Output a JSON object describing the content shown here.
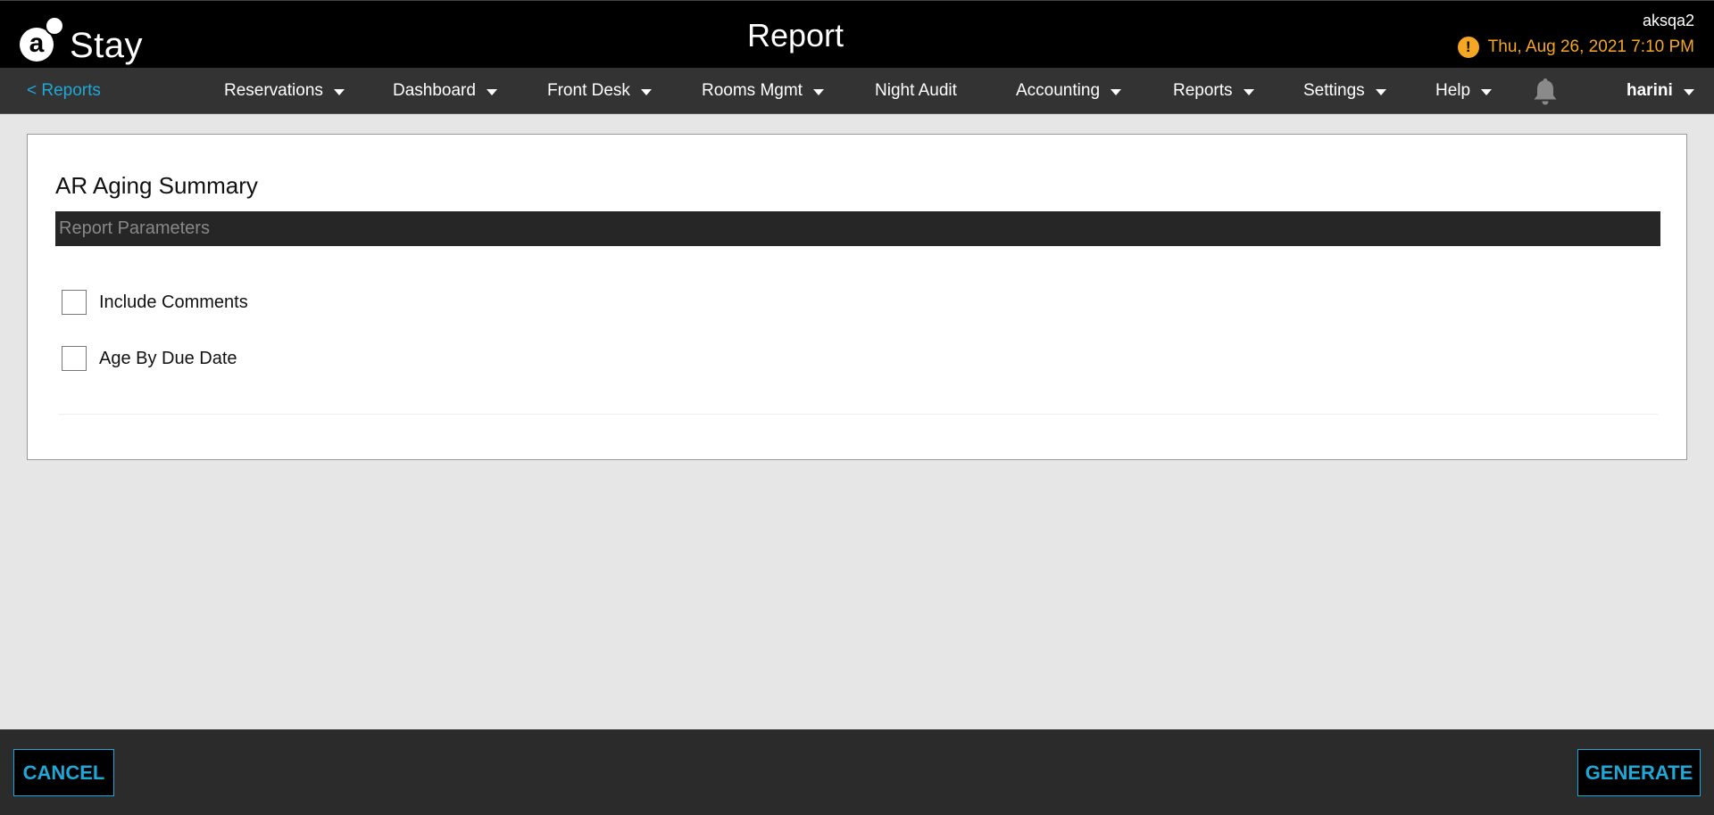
{
  "app": {
    "logo_letter": "a",
    "logo_text": "Stay",
    "page_title": "Report",
    "property": "aksqa2",
    "datetime": "Thu, Aug 26, 2021 7:10 PM",
    "warning_glyph": "!"
  },
  "nav": {
    "back_label": "< Reports",
    "items": [
      {
        "label": "Reservations",
        "dropdown": true
      },
      {
        "label": "Dashboard",
        "dropdown": true
      },
      {
        "label": "Front Desk",
        "dropdown": true
      },
      {
        "label": "Rooms Mgmt",
        "dropdown": true
      },
      {
        "label": "Night Audit",
        "dropdown": false
      },
      {
        "label": "Accounting",
        "dropdown": true
      },
      {
        "label": "Reports",
        "dropdown": true
      },
      {
        "label": "Settings",
        "dropdown": true
      },
      {
        "label": "Help",
        "dropdown": true
      }
    ],
    "notification_icon": "bell-icon",
    "user": "harini"
  },
  "report": {
    "title": "AR Aging Summary",
    "params_header": "Report Parameters",
    "options": [
      {
        "label": "Include Comments",
        "checked": false
      },
      {
        "label": "Age By Due Date",
        "checked": false
      }
    ]
  },
  "footer": {
    "cancel_label": "CANCEL",
    "generate_label": "GENERATE"
  },
  "colors": {
    "accent": "#1ea8d8",
    "warning": "#f5a623",
    "topbar": "#000000",
    "navbar": "#333333",
    "footer": "#2b2b2b"
  }
}
